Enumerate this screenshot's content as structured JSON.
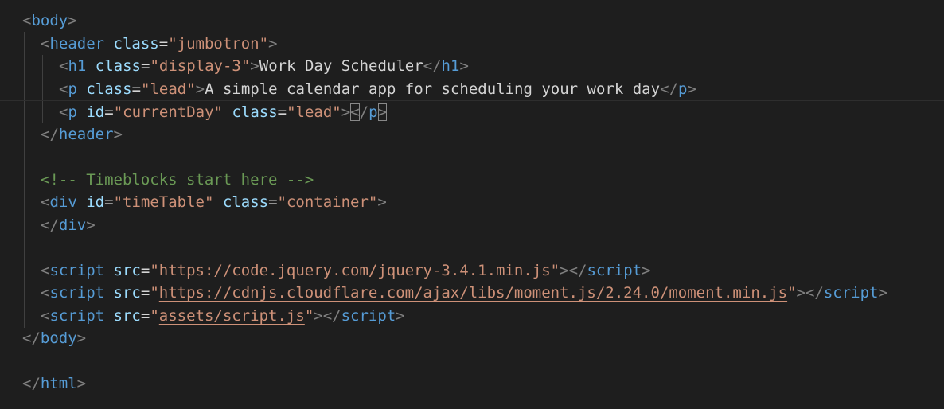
{
  "editor": {
    "theme_colors": {
      "background": "#1e1e1e",
      "tag": "#569cd6",
      "attribute": "#9cdcfe",
      "string": "#ce9178",
      "text": "#d4d4d4",
      "comment": "#6a9955",
      "bracket": "#808080"
    },
    "lines": {
      "l1": {
        "tag": "body"
      },
      "l2": {
        "tag": "header",
        "attr": "class",
        "value": "\"jumbotron\""
      },
      "l3": {
        "tag": "h1",
        "attr": "class",
        "value": "\"display-3\"",
        "text": "Work Day Scheduler",
        "close": "h1"
      },
      "l4": {
        "tag": "p",
        "attr": "class",
        "value": "\"lead\"",
        "text": "A simple calendar app for scheduling your work day",
        "close": "p"
      },
      "l5": {
        "tag": "p",
        "attr1": "id",
        "value1": "\"currentDay\"",
        "attr2": "class",
        "value2": "\"lead\"",
        "close": "p"
      },
      "l6": {
        "close": "header"
      },
      "l8": {
        "comment": "<!-- Timeblocks start here -->"
      },
      "l9": {
        "tag": "div",
        "attr1": "id",
        "value1": "\"timeTable\"",
        "attr2": "class",
        "value2": "\"container\""
      },
      "l10": {
        "close": "div"
      },
      "l12": {
        "tag": "script",
        "attr": "src",
        "url": "https://code.jquery.com/jquery-3.4.1.min.js",
        "close": "script"
      },
      "l13": {
        "tag": "script",
        "attr": "src",
        "url": "https://cdnjs.cloudflare.com/ajax/libs/moment.js/2.24.0/moment.min.js",
        "close": "script"
      },
      "l14": {
        "tag": "script",
        "attr": "src",
        "url": "assets/script.js",
        "close": "script"
      },
      "l15": {
        "close": "body"
      },
      "l17": {
        "close": "html"
      }
    }
  }
}
